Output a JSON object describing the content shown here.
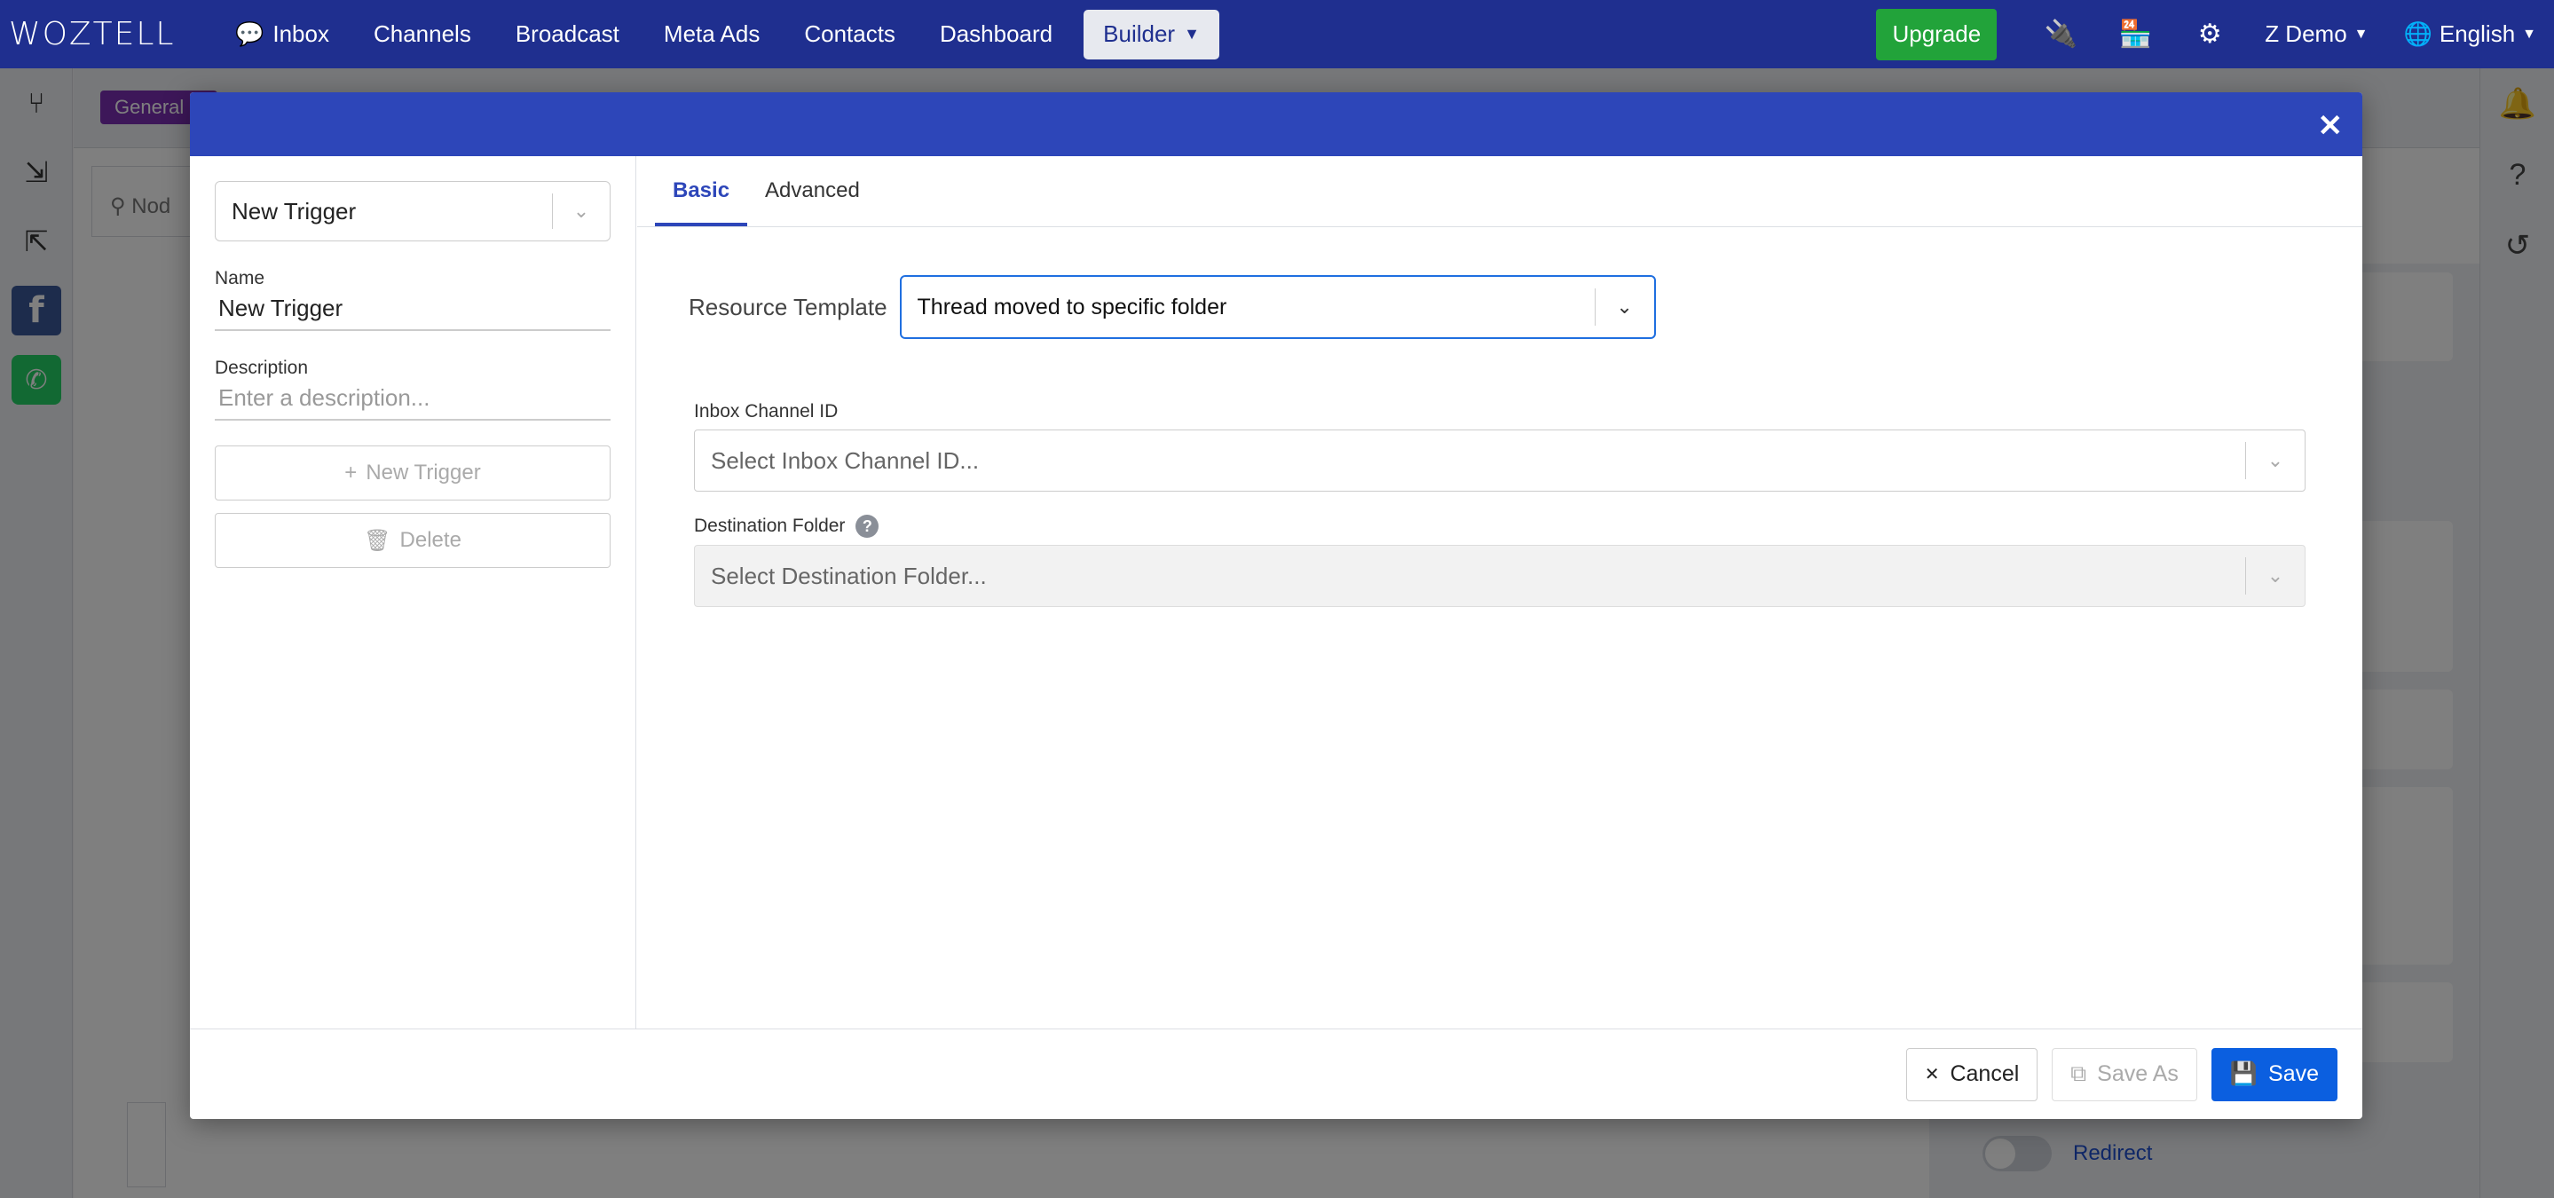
{
  "navbar": {
    "logo": "WOZTELL",
    "items": [
      {
        "label": "Inbox",
        "icon": "chat-icon"
      },
      {
        "label": "Channels"
      },
      {
        "label": "Broadcast"
      },
      {
        "label": "Meta Ads"
      },
      {
        "label": "Contacts"
      },
      {
        "label": "Dashboard"
      },
      {
        "label": "Builder",
        "active": true
      }
    ],
    "upgrade_label": "Upgrade",
    "user_label": "Z Demo",
    "language_label": "English"
  },
  "background": {
    "badge_label": "General C",
    "search_placeholder": "Nod",
    "redirect_label": "Redirect"
  },
  "modal": {
    "trigger_select": "New Trigger",
    "name_label": "Name",
    "name_value": "New Trigger",
    "description_label": "Description",
    "description_placeholder": "Enter a description...",
    "new_trigger_button": "New Trigger",
    "delete_button": "Delete",
    "tabs": [
      {
        "label": "Basic",
        "active": true
      },
      {
        "label": "Advanced",
        "active": false
      }
    ],
    "resource_template_label": "Resource Template",
    "resource_template_value": "Thread moved to specific folder",
    "inbox_channel_label": "Inbox Channel ID",
    "inbox_channel_placeholder": "Select Inbox Channel ID...",
    "destination_folder_label": "Destination Folder",
    "destination_folder_placeholder": "Select Destination Folder...",
    "cancel_button": "Cancel",
    "save_as_button": "Save As",
    "save_button": "Save"
  },
  "colors": {
    "navbar": "#1f2f8f",
    "modal_header": "#2d46b9",
    "upgrade": "#22a33a",
    "primary": "#0b5fe0",
    "badge": "#7b2fb3"
  }
}
